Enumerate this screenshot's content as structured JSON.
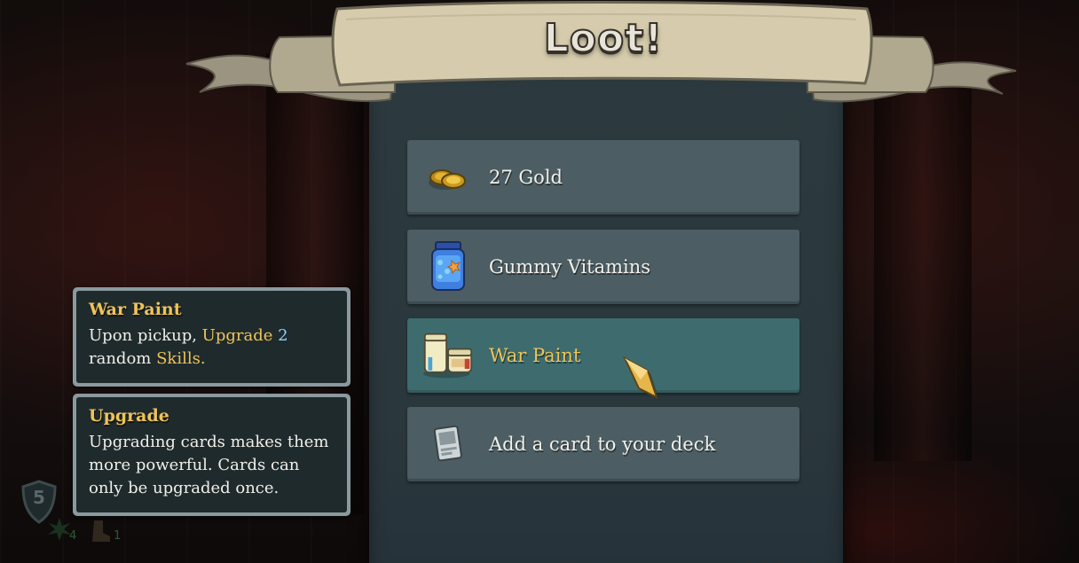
{
  "banner": {
    "title": "Loot!"
  },
  "rewards": [
    {
      "label": "27 Gold",
      "icon": "gold-coins-icon"
    },
    {
      "label": "Gummy Vitamins",
      "icon": "vitamin-jar-icon"
    },
    {
      "label": "War Paint",
      "icon": "war-paint-jars-icon",
      "selected": true
    },
    {
      "label": "Add a card to your deck",
      "icon": "card-icon"
    }
  ],
  "tooltips": [
    {
      "title": "War Paint",
      "line1_a": "Upon pickup, ",
      "line1_kw": "Upgrade",
      "line1_num": "2",
      "line2_a": "random ",
      "line2_kw": "Skills."
    },
    {
      "title": "Upgrade",
      "body": "Upgrading cards makes them more powerful. Cards can only be upgraded once."
    }
  ],
  "hud": {
    "level": "5",
    "stat_a": "4",
    "stat_b": "1"
  },
  "colors": {
    "keyword_gold": "#efc456",
    "keyword_blue": "#8fd3f2",
    "panel": "#2c3a3f",
    "row": "#4c5d63",
    "row_selected": "#3e6c6e"
  }
}
